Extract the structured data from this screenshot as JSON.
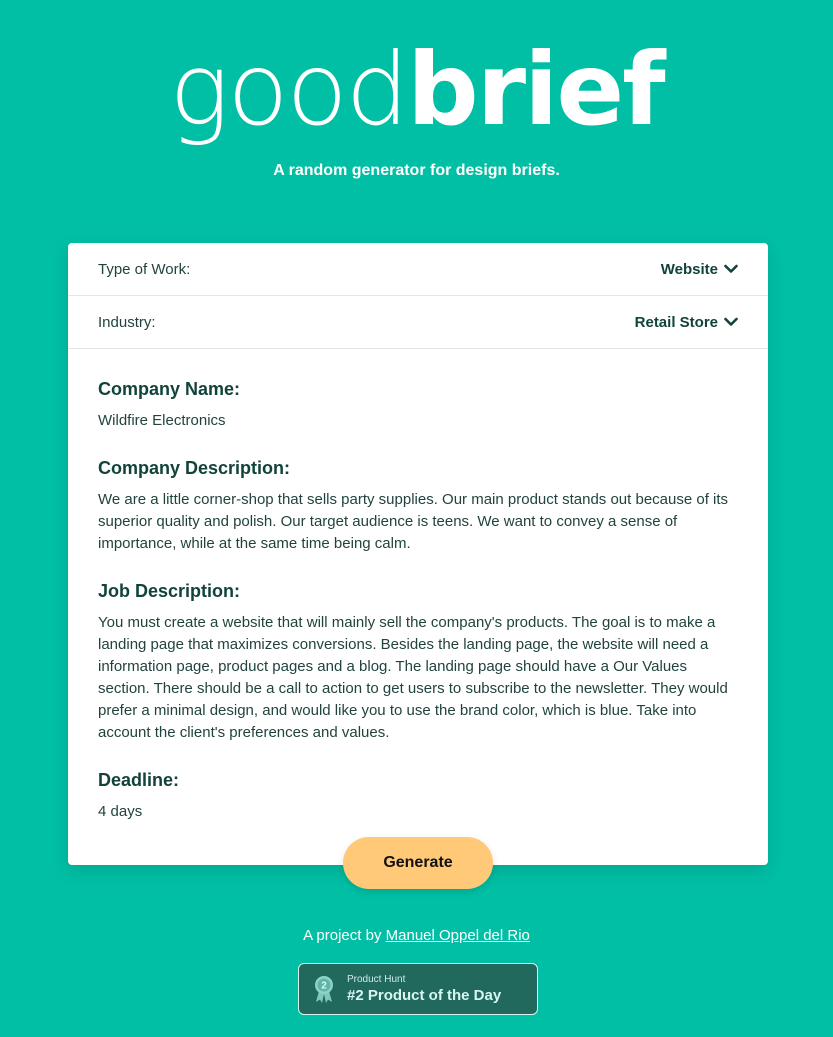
{
  "logo": {
    "light": "good",
    "bold": "brief"
  },
  "tagline": "A random generator for design briefs.",
  "filters": [
    {
      "label": "Type of Work:",
      "value": "Website"
    },
    {
      "label": "Industry:",
      "value": "Retail Store"
    }
  ],
  "brief": {
    "company_name_heading": "Company Name:",
    "company_name": "Wildfire Electronics",
    "company_description_heading": "Company Description:",
    "company_description": "We are a little corner-shop that sells party supplies. Our main product stands out because of its superior quality and polish. Our target audience is teens. We want to convey a sense of importance, while at the same time being calm.",
    "job_description_heading": "Job Description:",
    "job_description": "You must create a website that will mainly sell the company's products. The goal is to make a landing page that maximizes conversions. Besides the landing page, the website will need a information page, product pages and a blog. The landing page should have a Our Values section. There should be a call to action to get users to subscribe to the newsletter. They would prefer a minimal design, and would like you to use the brand color, which is blue. Take into account the client's preferences and values.",
    "deadline_heading": "Deadline:",
    "deadline": "4 days"
  },
  "generate_button": "Generate",
  "footer": {
    "prefix": "A project by",
    "author": "Manuel Oppel del Rio"
  },
  "product_hunt": {
    "small": "Product Hunt",
    "rank_number": "2",
    "title": "#2 Product of the Day"
  },
  "colors": {
    "background": "#00bfa5",
    "button": "#ffc978",
    "text": "#11433b",
    "badge": "#21685d"
  }
}
